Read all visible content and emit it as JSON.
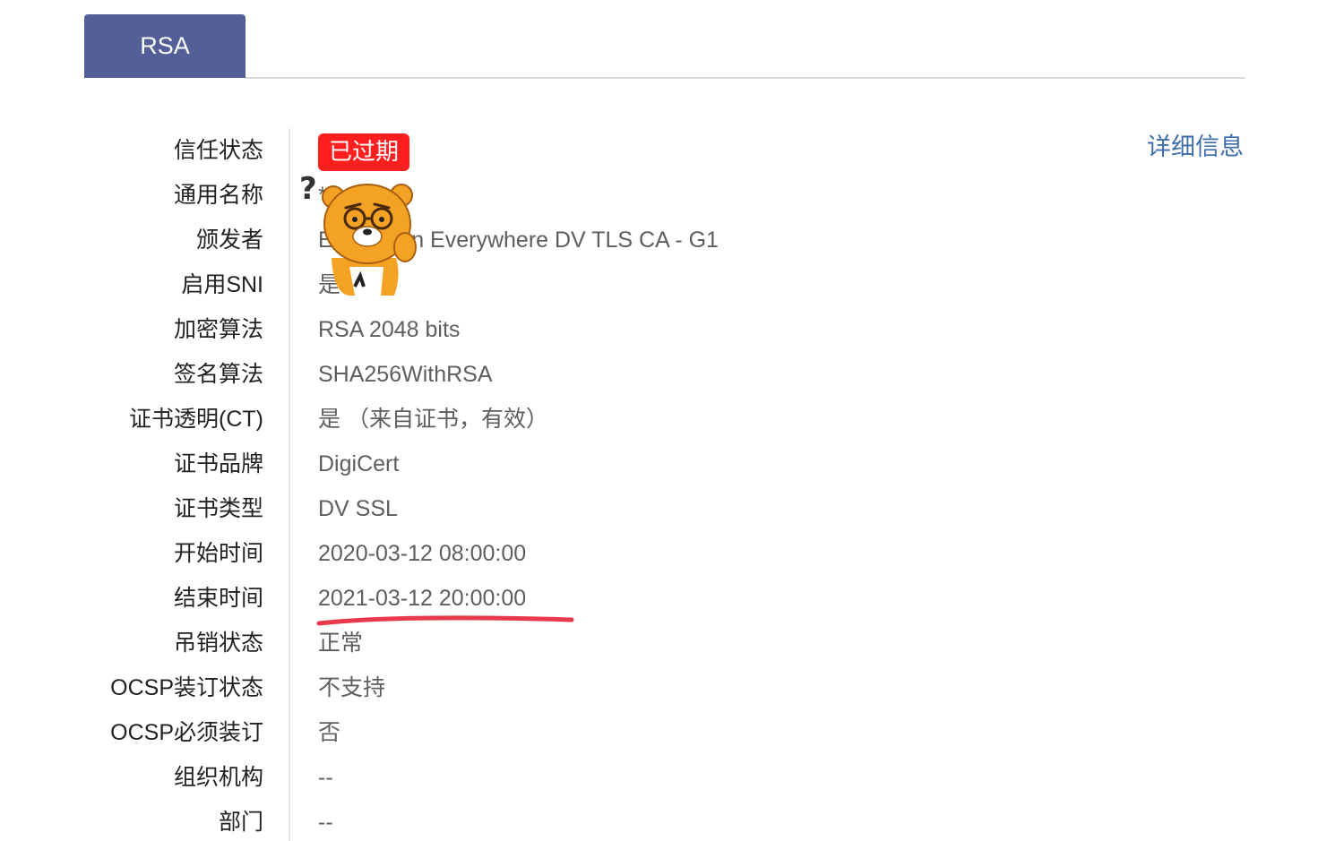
{
  "tabs": [
    {
      "label": "RSA",
      "active": true
    }
  ],
  "detail_link": "详细信息",
  "status_badge": "已过期",
  "fields": [
    {
      "label": "信任状态",
      "value": ""
    },
    {
      "label": "通用名称",
      "value": "*.          .com"
    },
    {
      "label": "颁发者",
      "value": "Encryption Everywhere DV TLS CA - G1"
    },
    {
      "label": "启用SNI",
      "value": "是"
    },
    {
      "label": "加密算法",
      "value": "RSA 2048 bits"
    },
    {
      "label": "签名算法",
      "value": "SHA256WithRSA"
    },
    {
      "label": "证书透明(CT)",
      "value": "是  （来自证书，有效）"
    },
    {
      "label": "证书品牌",
      "value": "DigiCert"
    },
    {
      "label": "证书类型",
      "value": "DV SSL"
    },
    {
      "label": "开始时间",
      "value": "2020-03-12 08:00:00"
    },
    {
      "label": "结束时间",
      "value": "2021-03-12 20:00:00"
    },
    {
      "label": "吊销状态",
      "value": "正常"
    },
    {
      "label": "OCSP装订状态",
      "value": "不支持"
    },
    {
      "label": "OCSP必须装订",
      "value": "否"
    },
    {
      "label": "组织机构",
      "value": "--"
    },
    {
      "label": "部门",
      "value": "--"
    }
  ],
  "colors": {
    "tab_active": "#525f98",
    "badge_expired": "#ff1f1f",
    "link": "#3e6dac",
    "underline": "#e8394a"
  },
  "icons": {
    "sticker": "thinking-bear-sticker-icon"
  }
}
